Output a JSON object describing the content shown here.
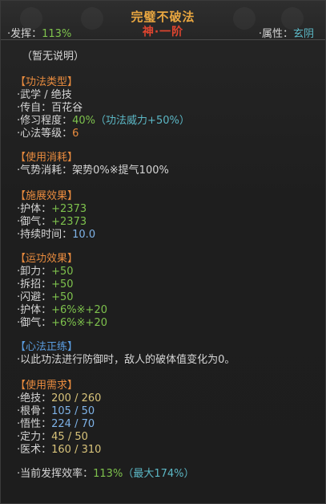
{
  "header": {
    "title": "完璧不破法",
    "rank": "神·一阶",
    "efficacy_label": "·发挥：",
    "efficacy_value": "113%",
    "attribute_label": "·属性：",
    "attribute_value": "玄阴"
  },
  "description": "（暂无说明）",
  "sections": {
    "type": {
      "title": "【功法类型】",
      "line1": "·武学 / 绝技",
      "line2": "·传自：百花谷",
      "line3_label": "·修习程度：",
      "line3_value": "40%",
      "line3_extra": "（功法威力+50%）",
      "line4_label": "·心法等级：",
      "line4_value": "6"
    },
    "cost": {
      "title": "【使用消耗】",
      "line1_label": "·气势消耗：",
      "line1_a": "架势0%",
      "line1_sep": "※",
      "line1_b": "提气100%"
    },
    "effect": {
      "title": "【施展效果】",
      "hu_label": "·护体：",
      "hu_value": "+2373",
      "yu_label": "·御气：",
      "yu_value": "+2373",
      "time_label": "·持续时间：",
      "time_value": "10.0"
    },
    "run": {
      "title": "【运功效果】",
      "l1_label": "·卸力：",
      "l1_value": "+50",
      "l2_label": "·拆招：",
      "l2_value": "+50",
      "l3_label": "·闪避：",
      "l3_value": "+50",
      "l4_label": "·护体：",
      "l4_value": "+6%※+20",
      "l5_label": "·御气：",
      "l5_value": "+6%※+20"
    },
    "zheng": {
      "title": "【心法正练】",
      "line1": "·以此功法进行防御时，敌人的破体值变化为0。"
    },
    "req": {
      "title": "【使用需求】",
      "r1_label": "·绝技：",
      "r1_value": "200 / 260",
      "r2_label": "·根骨：",
      "r2_value": "105 / 50",
      "r3_label": "·悟性：",
      "r3_value": "224 / 70",
      "r4_label": "·定力：",
      "r4_value": "45 / 50",
      "r5_label": "·医术：",
      "r5_value": "160 / 310"
    },
    "final": {
      "label": "·当前发挥效率：",
      "value": "113%",
      "max": "（最大174%）"
    }
  },
  "colors": {
    "title": "#e8a640",
    "rank": "#e0452f",
    "green": "#7ec24d",
    "cyan": "#5cb8c6",
    "orange": "#e88b3e",
    "blue": "#7fb3e8",
    "yellow": "#d8c37a",
    "section_orange": "#e88b3e",
    "section_blue": "#5b9de0"
  }
}
